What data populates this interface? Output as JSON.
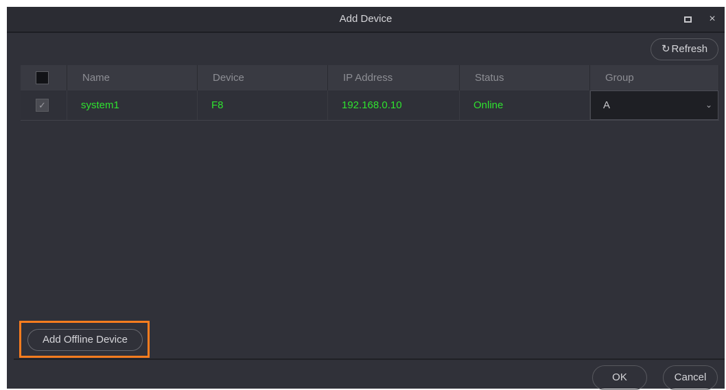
{
  "window": {
    "title": "Add Device",
    "maximize_icon": "maximize-icon",
    "close_glyph": "×"
  },
  "toolbar": {
    "refresh_label": "Refresh",
    "refresh_icon": "↻"
  },
  "table": {
    "columns": [
      "Name",
      "Device",
      "IP Address",
      "Status",
      "Group"
    ],
    "rows": [
      {
        "checked": true,
        "check_glyph": "✓",
        "name": "system1",
        "device": "F8",
        "ip": "192.168.0.10",
        "status": "Online",
        "group": "A",
        "group_chevron": "⌄"
      }
    ]
  },
  "actions": {
    "add_offline_label": "Add Offline Device",
    "ok_label": "OK",
    "cancel_label": "Cancel"
  },
  "colors": {
    "online_text": "#2fe22f",
    "highlight_border": "#ff7d1e",
    "dialog_bg": "#303139"
  }
}
